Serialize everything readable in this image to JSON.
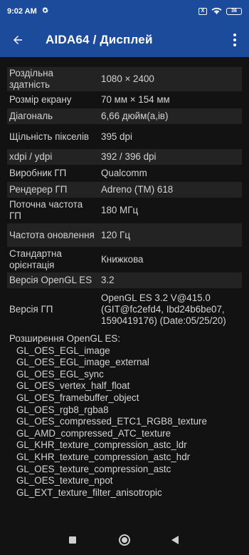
{
  "status_bar": {
    "time": "9:02 AM",
    "battery": "36",
    "xbox_glyph": "X"
  },
  "app_bar": {
    "title": "AIDA64  /  Дисплей"
  },
  "properties": [
    {
      "label": "Роздільна здатність",
      "value": "1080 × 2400"
    },
    {
      "label": "Розмір екрану",
      "value": "70 мм × 154 мм"
    },
    {
      "label": "Діагональ",
      "value": "6,66 дюйм(а,ів)"
    },
    {
      "label": "Щільність пікселів",
      "value": "395 dpi"
    },
    {
      "label": "xdpi / ydpi",
      "value": "392 / 396 dpi"
    },
    {
      "label": "Виробник ГП",
      "value": "Qualcomm"
    },
    {
      "label": "Рендерер ГП",
      "value": "Adreno (TM) 618"
    },
    {
      "label": "Поточна частота ГП",
      "value": "180 МГц"
    },
    {
      "label": "Частота оновлення",
      "value": "120 Гц"
    },
    {
      "label": "Стандартна орієнтація",
      "value": "Книжкова"
    },
    {
      "label": "Версія OpenGL ES",
      "value": "3.2"
    },
    {
      "label": "Версія ГП",
      "value": "OpenGL ES 3.2 V@415.0 (GIT@fc2efd4, Ibd24b6be07, 1590419176) (Date:05/25/20)"
    }
  ],
  "extensions": {
    "title": "Розширення OpenGL ES:",
    "items": [
      "GL_OES_EGL_image",
      "GL_OES_EGL_image_external",
      "GL_OES_EGL_sync",
      "GL_OES_vertex_half_float",
      "GL_OES_framebuffer_object",
      "GL_OES_rgb8_rgba8",
      "GL_OES_compressed_ETC1_RGB8_texture",
      "GL_AMD_compressed_ATC_texture",
      "GL_KHR_texture_compression_astc_ldr",
      "GL_KHR_texture_compression_astc_hdr",
      "GL_OES_texture_compression_astc",
      "GL_OES_texture_npot",
      "GL_EXT_texture_filter_anisotropic"
    ]
  },
  "icons": {
    "settings": "gear-icon",
    "back": "arrow-left-icon",
    "more": "more-vertical-icon",
    "wifi": "wifi-icon",
    "battery": "battery-icon"
  },
  "colors": {
    "app_bar": "#1d4b9c",
    "background": "#121212",
    "row_alt": "#232323",
    "text": "#d3d3d3"
  }
}
